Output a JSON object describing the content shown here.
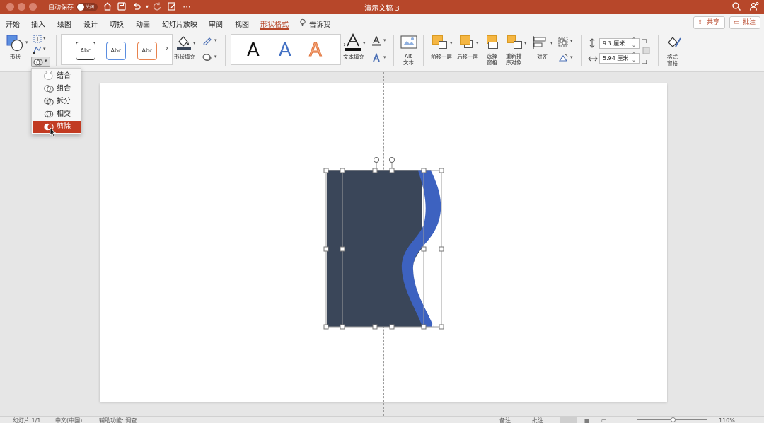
{
  "titlebar": {
    "autosave_label": "自动保存",
    "autosave_state": "关闭",
    "doc_title": "演示文稿 3",
    "more": "···",
    "bg_color": "#b7472a"
  },
  "tabs": [
    {
      "label": "开始"
    },
    {
      "label": "插入"
    },
    {
      "label": "绘图"
    },
    {
      "label": "设计"
    },
    {
      "label": "切换"
    },
    {
      "label": "动画"
    },
    {
      "label": "幻灯片放映"
    },
    {
      "label": "审阅"
    },
    {
      "label": "视图"
    },
    {
      "label": "形状格式",
      "active": true
    }
  ],
  "tell_me": "告诉我",
  "share_label": "共享",
  "comment_label": "批注",
  "ribbon": {
    "shapes_label": "形状",
    "style_sample": "Abc",
    "shape_fill_label": "形状填充",
    "wordart_letter": "A",
    "text_fill_label": "文本填充",
    "alt_text_line1": "Alt",
    "alt_text_line2": "文本",
    "bring_forward": "前移一层",
    "send_backward": "后移一层",
    "select_pane_line1": "选择",
    "select_pane_line2": "窗格",
    "reorder_line1": "重新排",
    "reorder_line2": "序对象",
    "align": "对齐",
    "height_value": "9.3 厘米",
    "width_value": "5.94 厘米",
    "format_pane_line1": "格式",
    "format_pane_line2": "窗格"
  },
  "merge_menu": {
    "items": [
      {
        "label": "结合",
        "icon": "union-icon"
      },
      {
        "label": "组合",
        "icon": "combine-icon"
      },
      {
        "label": "拆分",
        "icon": "fragment-icon"
      },
      {
        "label": "相交",
        "icon": "intersect-icon"
      },
      {
        "label": "剪除",
        "icon": "subtract-icon",
        "selected": true
      }
    ]
  },
  "colors": {
    "accent": "#b7472a",
    "menu_selected": "#c23b22",
    "shape_dark": "#3a4659",
    "shape_blue": "#3d62c0"
  },
  "statusbar": {
    "slide_info": "幻灯片 1/1",
    "language": "中文(中国)",
    "accessibility": "辅助功能: 调查",
    "notes": "备注",
    "comments": "批注",
    "zoom": "110%"
  }
}
